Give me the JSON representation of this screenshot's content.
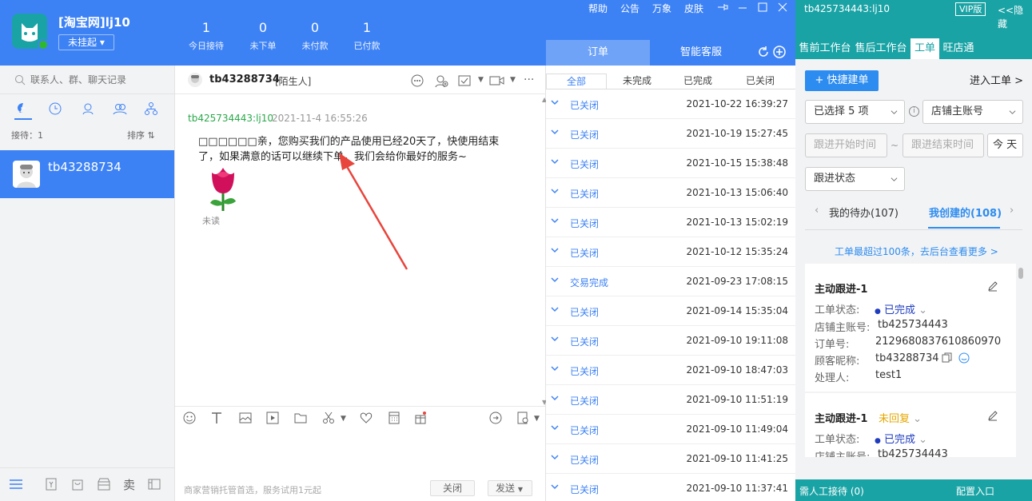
{
  "app": {
    "shop_name": "[淘宝网]lj10",
    "status": "未挂起"
  },
  "stats": [
    {
      "n": "1",
      "l": "今日接待"
    },
    {
      "n": "0",
      "l": "未下单"
    },
    {
      "n": "0",
      "l": "未付款"
    },
    {
      "n": "1",
      "l": "已付款"
    }
  ],
  "menu": {
    "help": "帮助",
    "notice": "公告",
    "wanxiang": "万象",
    "skin": "皮肤"
  },
  "order_tabs": {
    "orders": "订单",
    "smart": "智能客服"
  },
  "order_filters": [
    "全部",
    "未完成",
    "已完成",
    "已关闭"
  ],
  "orders": [
    {
      "status": "已关闭",
      "time": "2021-10-22 16:39:27"
    },
    {
      "status": "已关闭",
      "time": "2021-10-19 15:27:45"
    },
    {
      "status": "已关闭",
      "time": "2021-10-15 15:38:48"
    },
    {
      "status": "已关闭",
      "time": "2021-10-13 15:06:40"
    },
    {
      "status": "已关闭",
      "time": "2021-10-13 15:02:19"
    },
    {
      "status": "已关闭",
      "time": "2021-10-12 15:35:24"
    },
    {
      "status": "交易完成",
      "time": "2021-09-23 17:08:15"
    },
    {
      "status": "已关闭",
      "time": "2021-09-14 15:35:04"
    },
    {
      "status": "已关闭",
      "time": "2021-09-10 19:11:08"
    },
    {
      "status": "已关闭",
      "time": "2021-09-10 18:47:03"
    },
    {
      "status": "已关闭",
      "time": "2021-09-10 11:51:19"
    },
    {
      "status": "已关闭",
      "time": "2021-09-10 11:49:04"
    },
    {
      "status": "已关闭",
      "time": "2021-09-10 11:41:25"
    },
    {
      "status": "已关闭",
      "time": "2021-09-10 11:37:41"
    }
  ],
  "left": {
    "search_placeholder": "联系人、群、聊天记录",
    "waiting": "接待：1",
    "sort": "排序",
    "contact": "tb43288734"
  },
  "chat": {
    "peer": "tb43288734",
    "peer_tag": "[陌生人]",
    "sender": "tb425734443:lj10",
    "time": "2021-11-4 16:55:26",
    "line1": "□□□□□□亲，您购买我们的产品使用已经20天了，快使用结束",
    "line2": "了，如果满意的话可以继续下单，我们会给你最好的服务~",
    "unread": "未读",
    "promo": "商家营销托管首选，服务试用1元起",
    "close": "关闭",
    "send": "发送"
  },
  "right": {
    "account": "tb425734443:lj10",
    "vip": "VIP版",
    "hide": "<<隐藏",
    "tabs": [
      "售前工作台",
      "售后工作台",
      "工单",
      "旺店通"
    ],
    "quick": "+ 快捷建单",
    "enter": "进入工单 >",
    "selected": "已选择 5 项",
    "shop_account": "店铺主账号",
    "start_time": "跟进开始时间",
    "end_time": "跟进结束时间",
    "tilde": "~",
    "today": "今 天",
    "follow_status": "跟进状态",
    "todo": "我的待办(107)",
    "created": "我创建的(108)",
    "notice": "工单最超过100条，去后台查看更多 >",
    "card1": {
      "title": "主动跟进-1",
      "status_label": "工单状态:",
      "status": "已完成",
      "shop_label": "店铺主账号:",
      "shop": "tb425734443",
      "order_label": "订单号:",
      "order": "2129680837610860970",
      "nick_label": "顾客昵称:",
      "nick": "tb43288734",
      "handler_label": "处理人:",
      "handler": "test1"
    },
    "card2": {
      "title": "主动跟进-1",
      "tag": "未回复",
      "status_label": "工单状态:",
      "status": "已完成",
      "shop_label": "店铺主账号:",
      "shop": "tb425734443"
    },
    "footer_left": "需人工接待 (0)",
    "footer_right": "配置入口"
  },
  "colors": {
    "blue": "#3d82f5",
    "teal": "#1aa3a5",
    "red": "#e8453c"
  }
}
